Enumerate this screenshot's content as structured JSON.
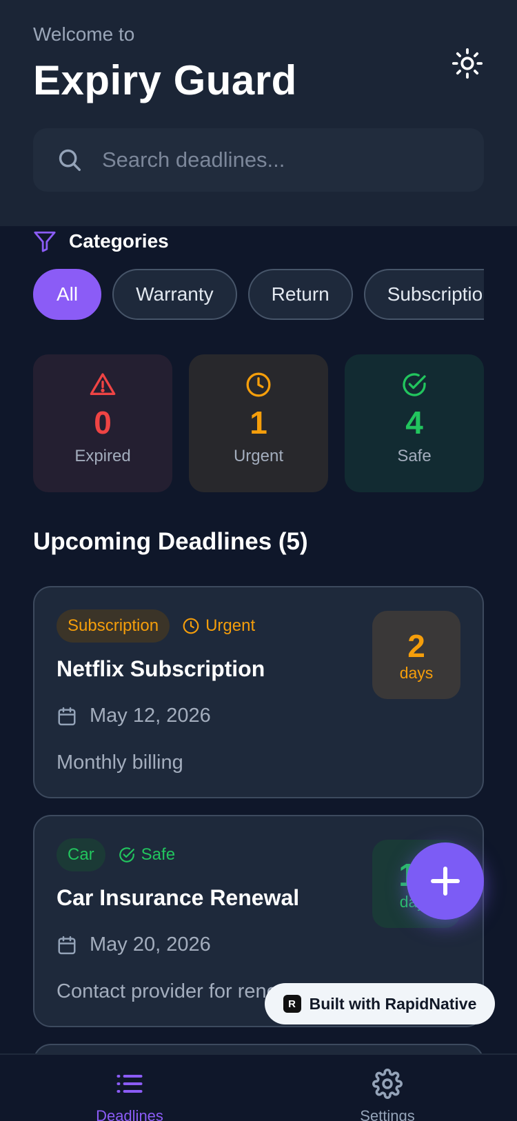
{
  "header": {
    "welcome": "Welcome to",
    "title": "Expiry Guard",
    "theme_icon": "sun-icon"
  },
  "search": {
    "placeholder": "Search deadlines...",
    "value": "",
    "icon": "search-icon"
  },
  "categories": {
    "label": "Categories",
    "icon": "filter-icon",
    "chips": [
      {
        "label": "All",
        "active": true
      },
      {
        "label": "Warranty",
        "active": false
      },
      {
        "label": "Return",
        "active": false
      },
      {
        "label": "Subscription",
        "active": false
      }
    ]
  },
  "stats": [
    {
      "key": "expired",
      "value": "0",
      "label": "Expired",
      "icon": "alert-triangle-icon",
      "color": "#ef4444"
    },
    {
      "key": "urgent",
      "value": "1",
      "label": "Urgent",
      "icon": "clock-icon",
      "color": "#f59e0b"
    },
    {
      "key": "safe",
      "value": "4",
      "label": "Safe",
      "icon": "check-circle-icon",
      "color": "#22c55e"
    }
  ],
  "section": {
    "title": "Upcoming Deadlines (5)"
  },
  "deadlines": [
    {
      "category": "Subscription",
      "status": "Urgent",
      "title": "Netflix Subscription",
      "date": "May 12, 2026",
      "note": "Monthly billing",
      "days": "2",
      "days_label": "days"
    },
    {
      "category": "Car",
      "status": "Safe",
      "title": "Car Insurance Renewal",
      "date": "May 20, 2026",
      "note": "Contact provider for renewal",
      "days": "10",
      "days_label": "days"
    }
  ],
  "fab": {
    "icon": "plus-icon"
  },
  "badge": {
    "label": "Built with RapidNative",
    "logo": "R"
  },
  "tabbar": {
    "tabs": [
      {
        "label": "Deadlines",
        "icon": "list-icon",
        "active": true
      },
      {
        "label": "Settings",
        "icon": "gear-icon",
        "active": false
      }
    ]
  },
  "colors": {
    "accent": "#8b5cf6",
    "urgent": "#f59e0b",
    "safe": "#22c55e",
    "expired": "#ef4444"
  }
}
